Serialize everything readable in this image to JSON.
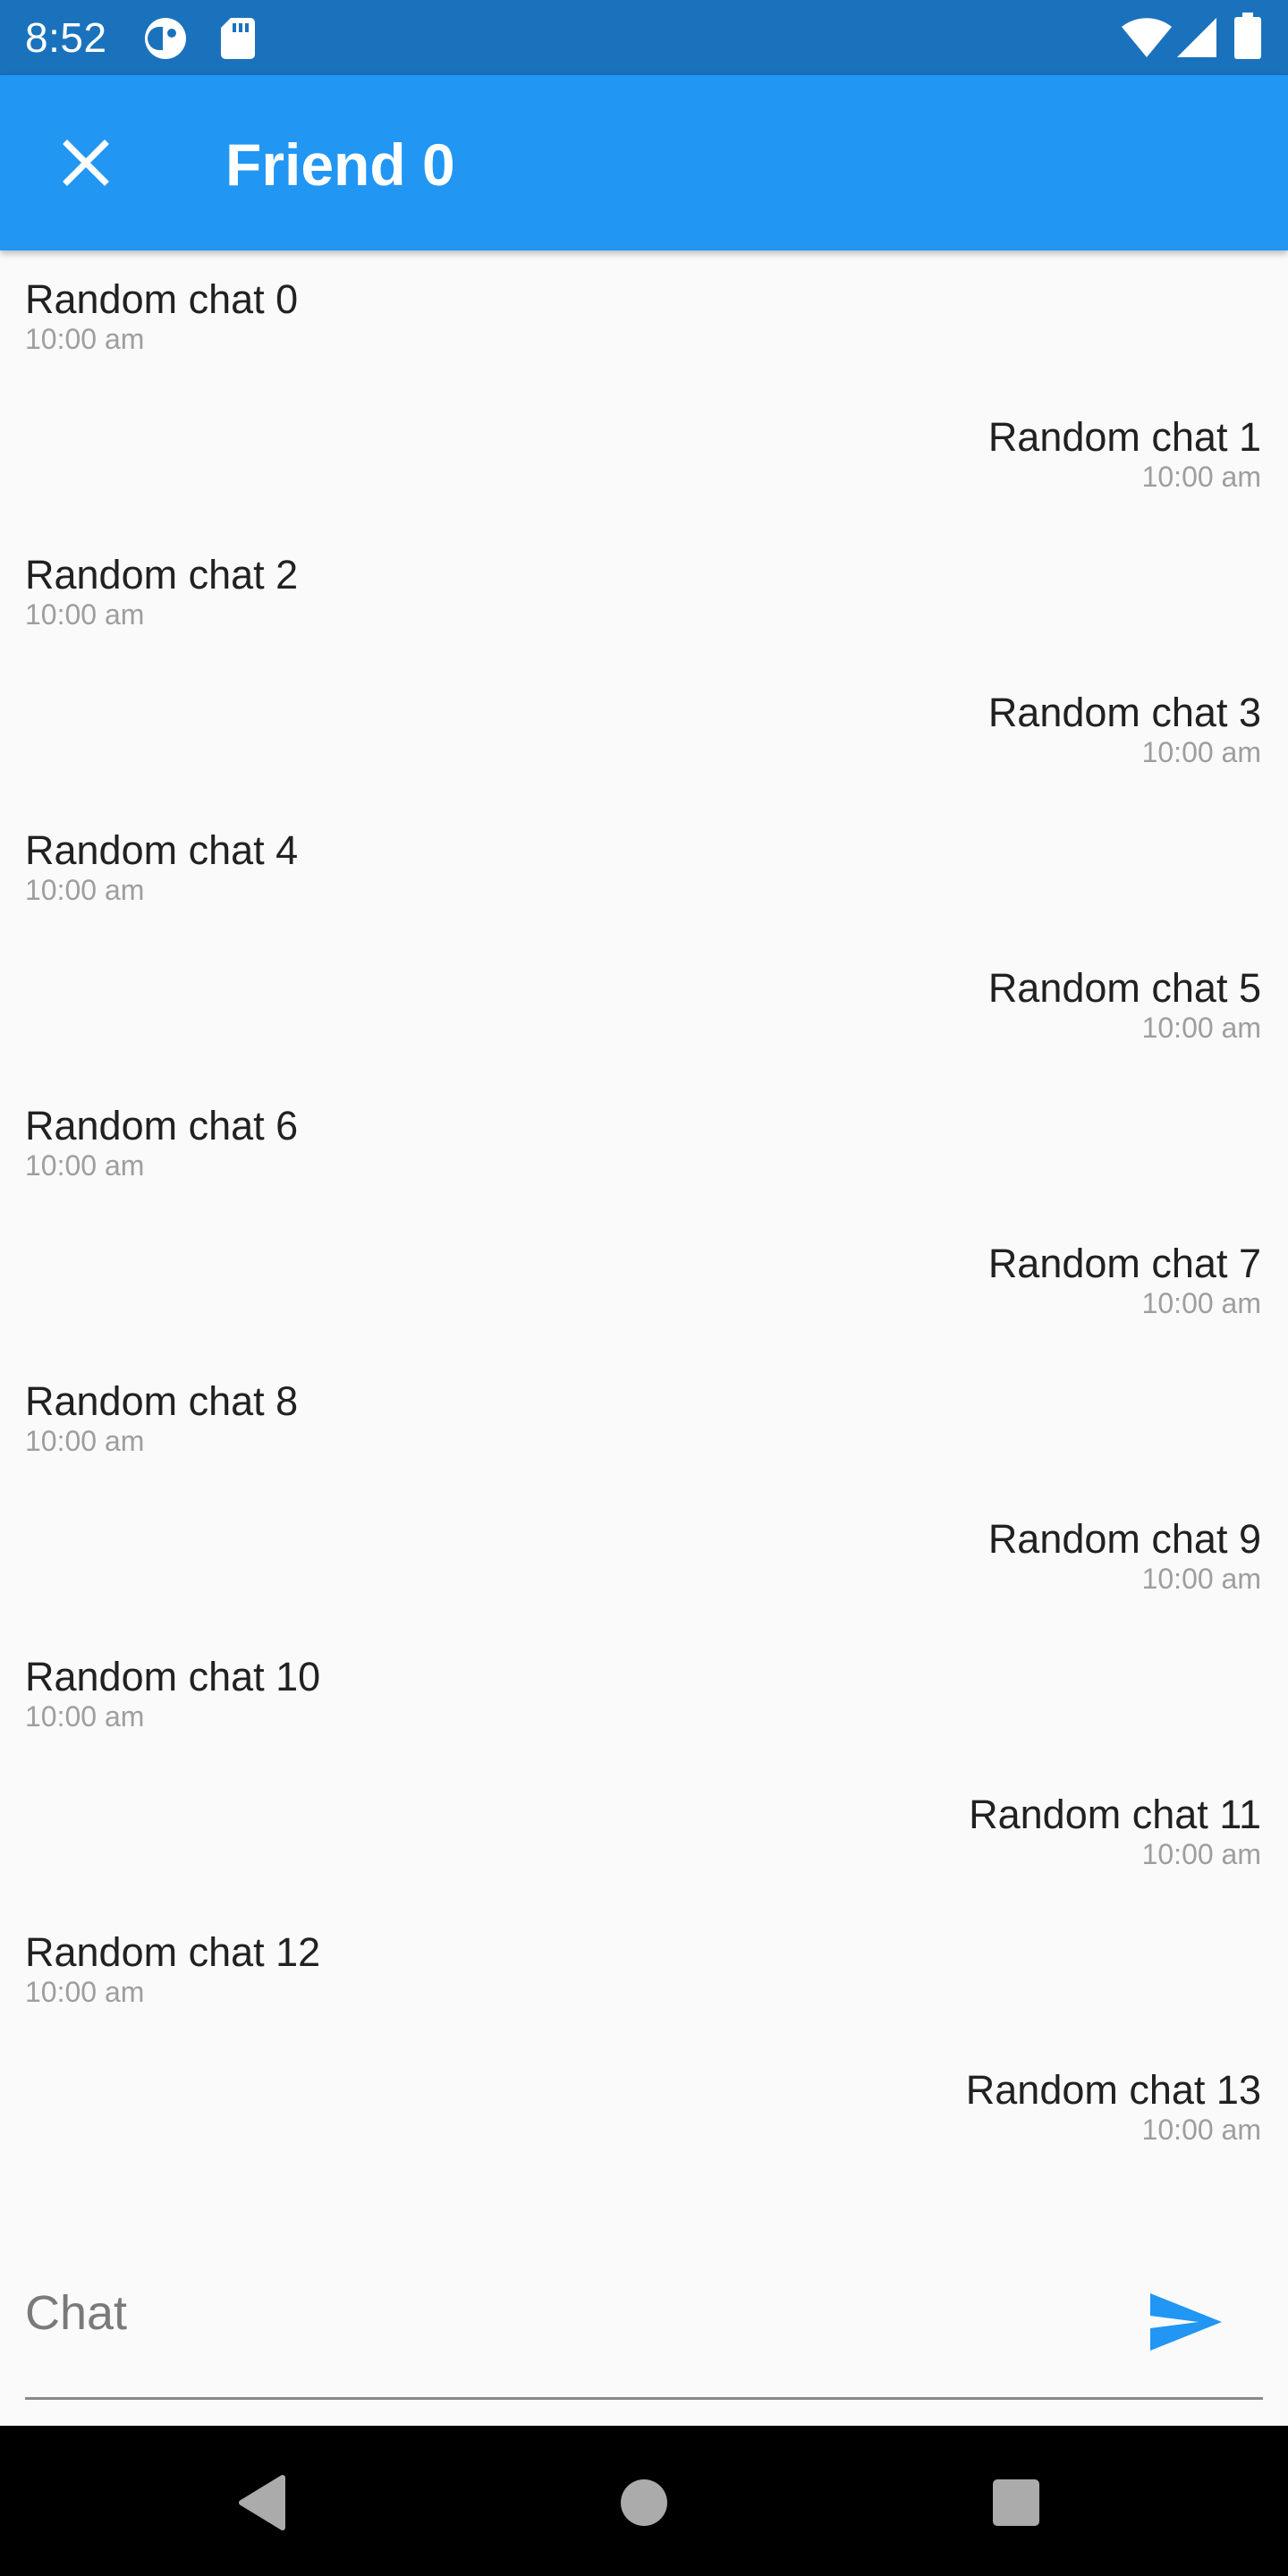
{
  "status_bar": {
    "time": "8:52",
    "icons": [
      "cloud-app-icon",
      "sd-card-icon",
      "wifi-icon",
      "cell-signal-icon",
      "battery-icon"
    ]
  },
  "app_bar": {
    "title": "Friend 0",
    "close_icon": "close-icon",
    "background_color": "#2196f3"
  },
  "messages": [
    {
      "text": "Random chat 0",
      "time": "10:00 am",
      "side": "left"
    },
    {
      "text": "Random chat 1",
      "time": "10:00 am",
      "side": "right"
    },
    {
      "text": "Random chat 2",
      "time": "10:00 am",
      "side": "left"
    },
    {
      "text": "Random chat 3",
      "time": "10:00 am",
      "side": "right"
    },
    {
      "text": "Random chat 4",
      "time": "10:00 am",
      "side": "left"
    },
    {
      "text": "Random chat 5",
      "time": "10:00 am",
      "side": "right"
    },
    {
      "text": "Random chat 6",
      "time": "10:00 am",
      "side": "left"
    },
    {
      "text": "Random chat 7",
      "time": "10:00 am",
      "side": "right"
    },
    {
      "text": "Random chat 8",
      "time": "10:00 am",
      "side": "left"
    },
    {
      "text": "Random chat 9",
      "time": "10:00 am",
      "side": "right"
    },
    {
      "text": "Random chat 10",
      "time": "10:00 am",
      "side": "left"
    },
    {
      "text": "Random chat 11",
      "time": "10:00 am",
      "side": "right"
    },
    {
      "text": "Random chat 12",
      "time": "10:00 am",
      "side": "left"
    },
    {
      "text": "Random chat 13",
      "time": "10:00 am",
      "side": "right"
    }
  ],
  "composer": {
    "placeholder": "Chat",
    "value": "",
    "send_icon": "send-icon",
    "accent_color": "#2196f3"
  },
  "nav_bar": {
    "icons": [
      "back-icon",
      "home-icon",
      "recents-icon"
    ]
  }
}
